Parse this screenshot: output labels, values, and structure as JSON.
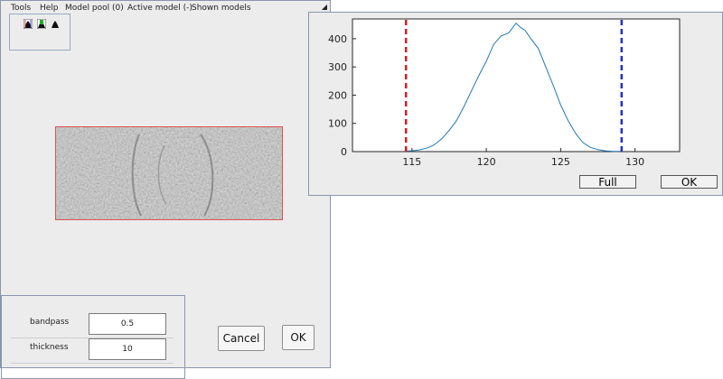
{
  "menubar": {
    "items": [
      "Tools",
      "Help",
      "Model pool (0)",
      "Active model (-)",
      "Shown models"
    ]
  },
  "toolbar": {
    "icons": [
      "histogram-black-icon",
      "histogram-green-icon",
      "histogram-black-icon"
    ]
  },
  "params": {
    "bandpass_label": "bandpass",
    "bandpass_value": "0.5",
    "thickness_label": "thickness",
    "thickness_value": "10"
  },
  "buttons": {
    "cancel": "Cancel",
    "ok": "OK"
  },
  "histogram_window": {
    "full_button": "Full",
    "ok_button": "OK"
  },
  "chart_data": {
    "type": "line",
    "xlim": [
      111,
      133
    ],
    "ylim": [
      0,
      470
    ],
    "x_ticks": [
      115,
      120,
      125,
      130
    ],
    "y_ticks": [
      0,
      100,
      200,
      300,
      400
    ],
    "grid": false,
    "series": [
      {
        "color": "#1f77b4",
        "x": [
          114.5,
          115,
          115.5,
          116,
          116.5,
          117,
          117.5,
          118,
          118.5,
          119,
          119.5,
          120,
          120.5,
          121,
          121.5,
          122,
          122.3,
          122.6,
          123,
          123.5,
          124,
          124.5,
          125,
          125.5,
          126,
          126.5,
          127,
          127.5,
          128,
          128.5,
          129
        ],
        "y": [
          2,
          3,
          6,
          12,
          24,
          45,
          75,
          110,
          160,
          215,
          270,
          320,
          380,
          410,
          420,
          455,
          440,
          430,
          400,
          365,
          300,
          235,
          165,
          110,
          65,
          32,
          15,
          7,
          3,
          1,
          1
        ]
      }
    ],
    "markers": [
      {
        "x": 114.6,
        "color": "#d62020",
        "style": "dashed"
      },
      {
        "x": 129.1,
        "color": "#1f2fd6",
        "style": "dashed"
      }
    ]
  }
}
